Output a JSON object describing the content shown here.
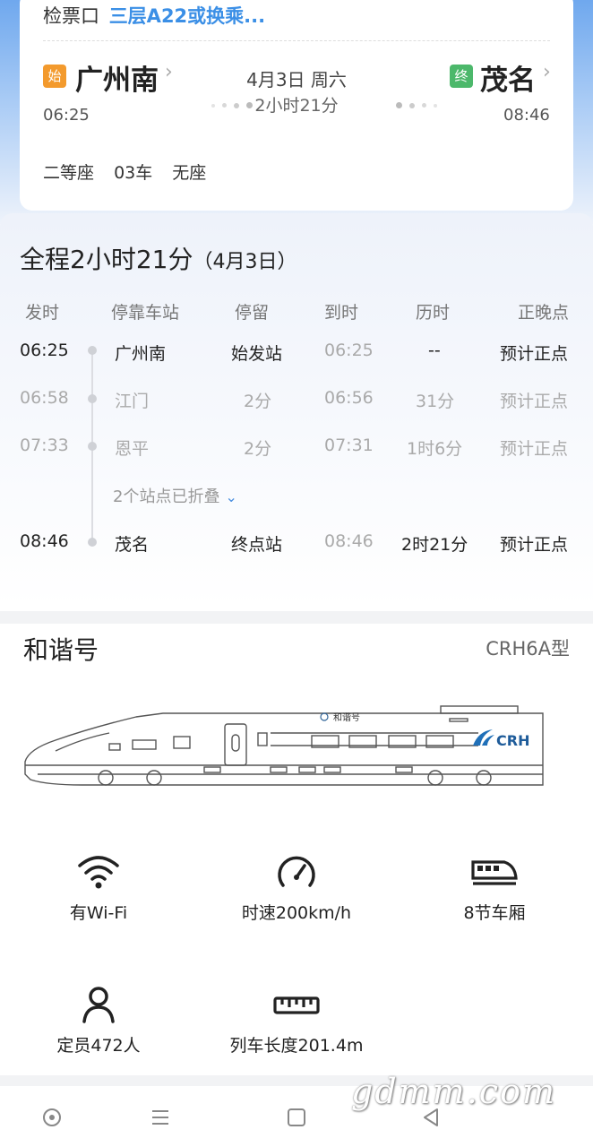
{
  "ticket": {
    "gate_label": "检票口",
    "gate_value": "三层A22或换乘...",
    "from_badge": "始",
    "to_badge": "终",
    "from_station": "广州南",
    "to_station": "茂名",
    "date": "4月3日 周六",
    "duration": "2小时21分",
    "dep_time": "06:25",
    "arr_time": "08:46",
    "seat_class": "二等座",
    "car": "03车",
    "seat": "无座"
  },
  "schedule": {
    "title": "全程2小时21分",
    "title_date": "（4月3日）",
    "headers": [
      "发时",
      "停靠车站",
      "停留",
      "到时",
      "历时",
      "正晚点"
    ],
    "rows": [
      {
        "dep": "06:25",
        "station": "广州南",
        "stop": "始发站",
        "arr": "06:25",
        "elapsed": "--",
        "status": "预计正点"
      },
      {
        "dep": "06:58",
        "station": "江门",
        "stop": "2分",
        "arr": "06:56",
        "elapsed": "31分",
        "status": "预计正点"
      },
      {
        "dep": "07:33",
        "station": "恩平",
        "stop": "2分",
        "arr": "07:31",
        "elapsed": "1时6分",
        "status": "预计正点"
      },
      {
        "dep": "08:46",
        "station": "茂名",
        "stop": "终点站",
        "arr": "08:46",
        "elapsed": "2时21分",
        "status": "预计正点"
      }
    ],
    "folded_text": "2个站点已折叠"
  },
  "train": {
    "name": "和谐号",
    "model": "CRH6A型",
    "body_logo": "和谐号",
    "body_brand": "CRH"
  },
  "features": [
    {
      "icon": "wifi-icon",
      "label": "有Wi-Fi"
    },
    {
      "icon": "speedometer-icon",
      "label": "时速200km/h"
    },
    {
      "icon": "train-car-icon",
      "label": "8节车厢"
    },
    {
      "icon": "person-icon",
      "label": "定员472人"
    },
    {
      "icon": "ruler-icon",
      "label": "列车长度201.4m"
    }
  ],
  "watermark": "gdmm.com",
  "colors": {
    "accent_blue": "#3b8fe6",
    "start_badge": "#f39a2d",
    "end_badge": "#4cb86b"
  }
}
